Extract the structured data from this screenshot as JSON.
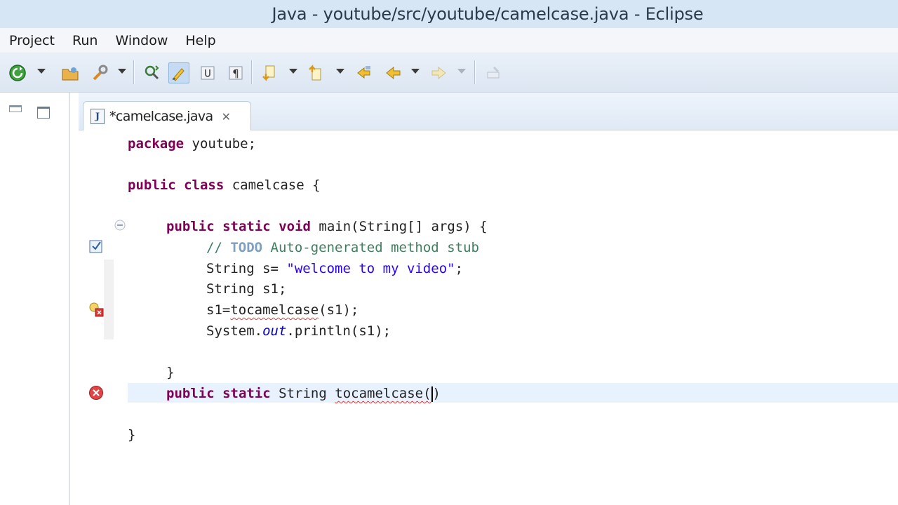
{
  "window": {
    "title": "Java - youtube/src/youtube/camelcase.java - Eclipse"
  },
  "menu": {
    "items": [
      "Project",
      "Run",
      "Window",
      "Help"
    ]
  },
  "toolbar": {
    "buttons": [
      "run-icon",
      "open-project-icon",
      "wrench-icon",
      "open-type-icon",
      "highlight-icon",
      "toggle-mark-icon",
      "show-whitespace-icon",
      "next-annotation-icon",
      "previous-annotation-icon",
      "last-edit-icon",
      "back-icon",
      "forward-icon",
      "pin-editor-icon"
    ]
  },
  "editor": {
    "tab": {
      "label": "*camelcase.java",
      "icon": "java-file-icon",
      "dirty": true
    },
    "code": {
      "l1_kw": "package",
      "l1_rest": " youtube;",
      "l2_kw1": "public",
      "l2_kw2": "class",
      "l2_rest": " camelcase {",
      "l3_kw1": "public",
      "l3_kw2": "static",
      "l3_kw3": "void",
      "l3_rest": " main(String[] args) {",
      "l4_comment_start": "// ",
      "l4_todo": "TODO",
      "l4_comment_rest": " Auto-generated method stub",
      "l5_pre": "String s= ",
      "l5_str": "\"welcome to my video\"",
      "l5_post": ";",
      "l6": "String s1;",
      "l7_pre": "s1=",
      "l7_err": "tocamelcase",
      "l7_post": "(s1);",
      "l8_pre": "System.",
      "l8_field": "out",
      "l8_post": ".println(s1);",
      "l9": "}",
      "l10_kw1": "public",
      "l10_kw2": "static",
      "l10_rest": " String ",
      "l10_err": "tocamelcase(",
      "l10_close": ")",
      "l11": "}"
    }
  },
  "colors": {
    "keyword": "#7f0055",
    "string": "#2a00ff",
    "comment": "#3f7f5f",
    "field": "#0000c0",
    "error": "#e53935"
  }
}
